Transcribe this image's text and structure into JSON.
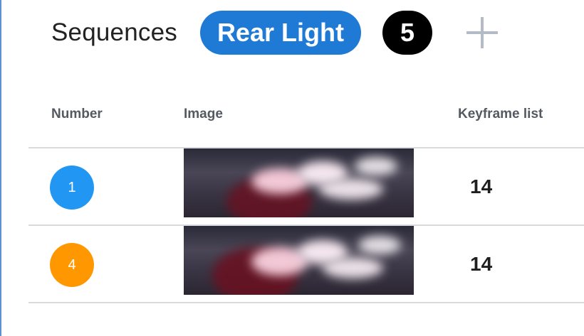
{
  "header": {
    "title": "Sequences",
    "category_chip": "Rear Light",
    "sequence_count": "5",
    "add_icon": "plus-icon"
  },
  "table": {
    "columns": [
      "Number",
      "Image",
      "Keyframe list"
    ],
    "rows": [
      {
        "number": "1",
        "badge_color": "#2196f3",
        "keyframes": "14"
      },
      {
        "number": "4",
        "badge_color": "#ff9800",
        "keyframes": "14"
      }
    ]
  },
  "colors": {
    "accent": "#1f7ad6",
    "count_badge": "#000000",
    "border": "#5b8fd6"
  }
}
